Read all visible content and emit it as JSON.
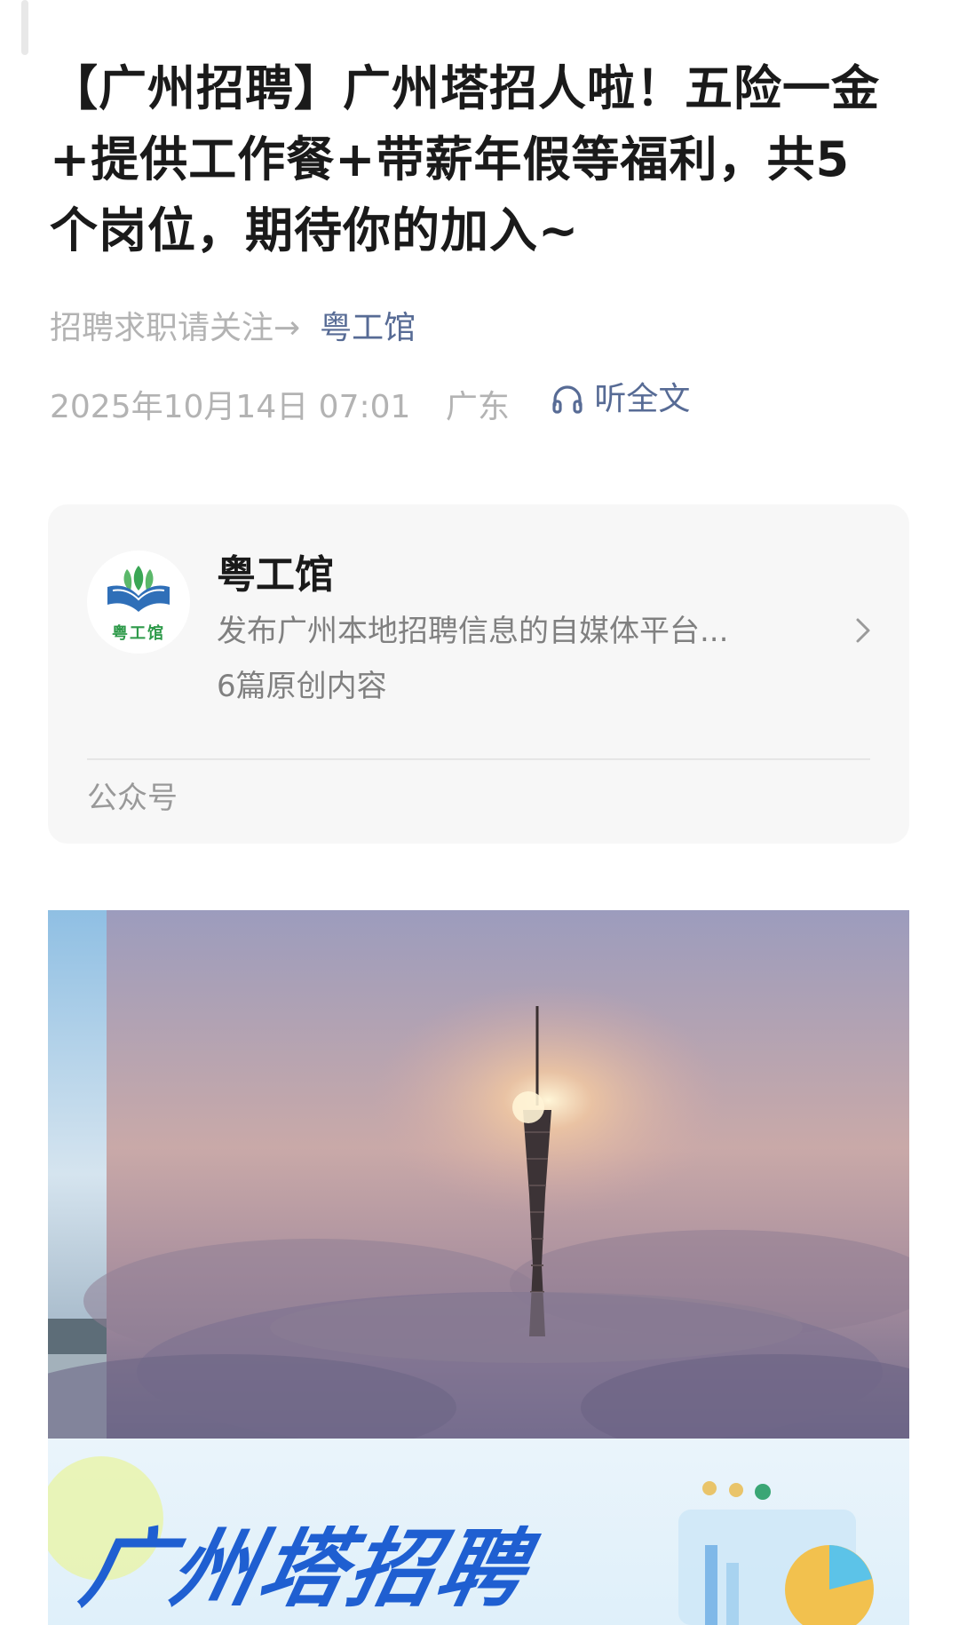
{
  "article": {
    "title": "【广州招聘】广州塔招人啦！五险一金+提供工作餐+带薪年假等福利，共5个岗位，期待你的加入~",
    "byline_prefix": "招聘求职请关注→",
    "account": "粤工馆",
    "datetime": "2025年10月14日 07:01",
    "region": "广东",
    "listen_label": "听全文"
  },
  "account_card": {
    "name": "粤工馆",
    "logo_text": "粤工馆",
    "description": "发布广州本地招聘信息的自媒体平台...",
    "original_count": "6篇原创内容",
    "type": "公众号"
  },
  "banner": {
    "title": "广州塔招聘"
  },
  "icons": {
    "listen": "headphones-icon",
    "arrow": "chevron-right-icon"
  },
  "colors": {
    "link": "#576b95",
    "muted": "#b3b3b3",
    "card_bg": "#f7f7f7",
    "banner_text": "#1f5fd1"
  }
}
